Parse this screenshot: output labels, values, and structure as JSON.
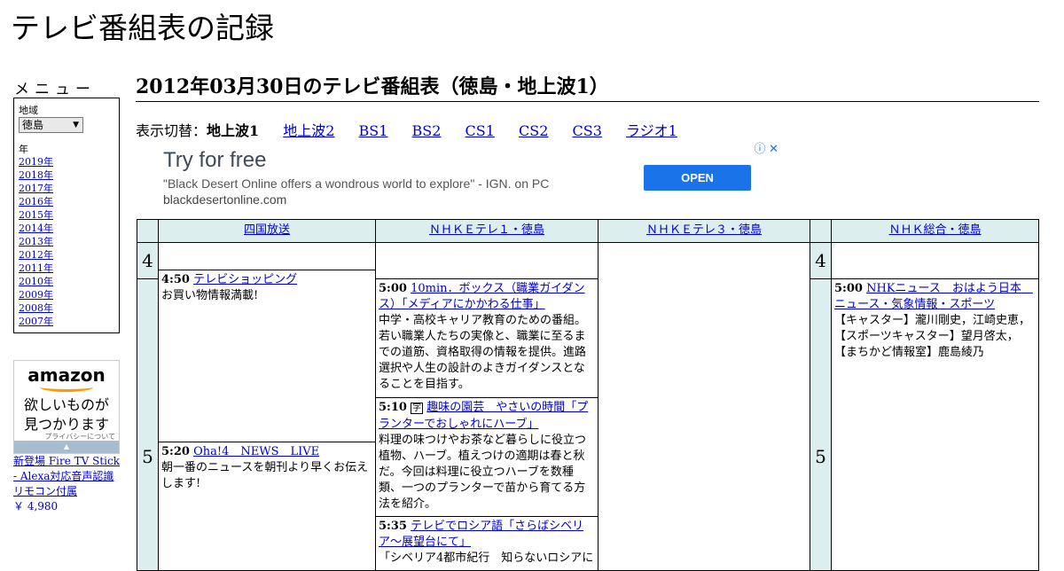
{
  "site": {
    "title": "テレビ番組表の記録"
  },
  "menu": {
    "label": "メニュー",
    "region_label": "地域",
    "region_value": "徳島",
    "year_label": "年",
    "years": [
      "2019年",
      "2018年",
      "2017年",
      "2016年",
      "2015年",
      "2014年",
      "2013年",
      "2012年",
      "2011年",
      "2010年",
      "2009年",
      "2008年",
      "2007年"
    ]
  },
  "amazon_ad": {
    "logo": "amazon",
    "message_line1": "欲しいものが",
    "message_line2": "見つかります",
    "privacy": "プライバシーについて",
    "product": "新登場 Fire TV Stick - Alexa対応音声認識リモコン付属",
    "price": "￥ 4,980"
  },
  "page": {
    "title": "2012年03月30日のテレビ番組表（徳島・地上波1）"
  },
  "switcher": {
    "label": "表示切替：",
    "current": "地上波1",
    "links": [
      "地上波2",
      "BS1",
      "BS2",
      "CS1",
      "CS2",
      "CS3",
      "ラジオ1"
    ]
  },
  "ad_banner": {
    "headline": "Try for free",
    "description": "\"Black Desert Online offers a wondrous world to explore\" - IGN. on PC",
    "url": "blackdesertonline.com",
    "button": "OPEN"
  },
  "schedule": {
    "channels": [
      "四国放送",
      "ＮＨＫＥテレ１・徳島",
      "ＮＨＫＥテレ３・徳島",
      "ＮＨＫ総合・徳島"
    ],
    "hours": [
      "4",
      "5"
    ],
    "programs": {
      "ch1_a": {
        "time": "4:50",
        "title": "テレビショッピング",
        "desc": "お買い物情報満載!"
      },
      "ch1_b": {
        "time": "5:20",
        "title": "Oha!4　NEWS　LIVE",
        "desc": "朝一番のニュースを朝刊より早くお伝えします!"
      },
      "ch2_a": {
        "time": "5:00",
        "title": "10min．ボックス（職業ガイダンス）「メディアにかかわる仕事」",
        "desc": "中学・高校キャリア教育のための番組。若い職業人たちの実像と、職業に至るまでの道筋、資格取得の情報を提供。進路選択や人生の設計のよきガイダンスとなることを目指す。"
      },
      "ch2_b": {
        "time": "5:10",
        "icon": "字",
        "title": "趣味の園芸　やさいの時間「プランターでおしゃれにハーブ」",
        "desc": "料理の味つけやお茶など暮らしに役立つ植物、ハーブ。植えつけの適期は春と秋だ。今回は料理に役立つハーブを数種類、一つのプランターで苗から育てる方法を紹介。"
      },
      "ch2_c": {
        "time": "5:35",
        "title": "テレビでロシア語「さらばシベリア～展望台にて」",
        "desc": "「シベリア4都市紀行　知らないロシアに"
      },
      "ch4_a": {
        "time": "5:00",
        "title": "NHKニュース　おはよう日本　ニュース・気象情報・スポーツ",
        "desc": "【キャスター】瀧川剛史，江崎史恵，【スポーツキャスター】望月啓太，【まちかど情報室】鹿島綾乃"
      }
    }
  }
}
